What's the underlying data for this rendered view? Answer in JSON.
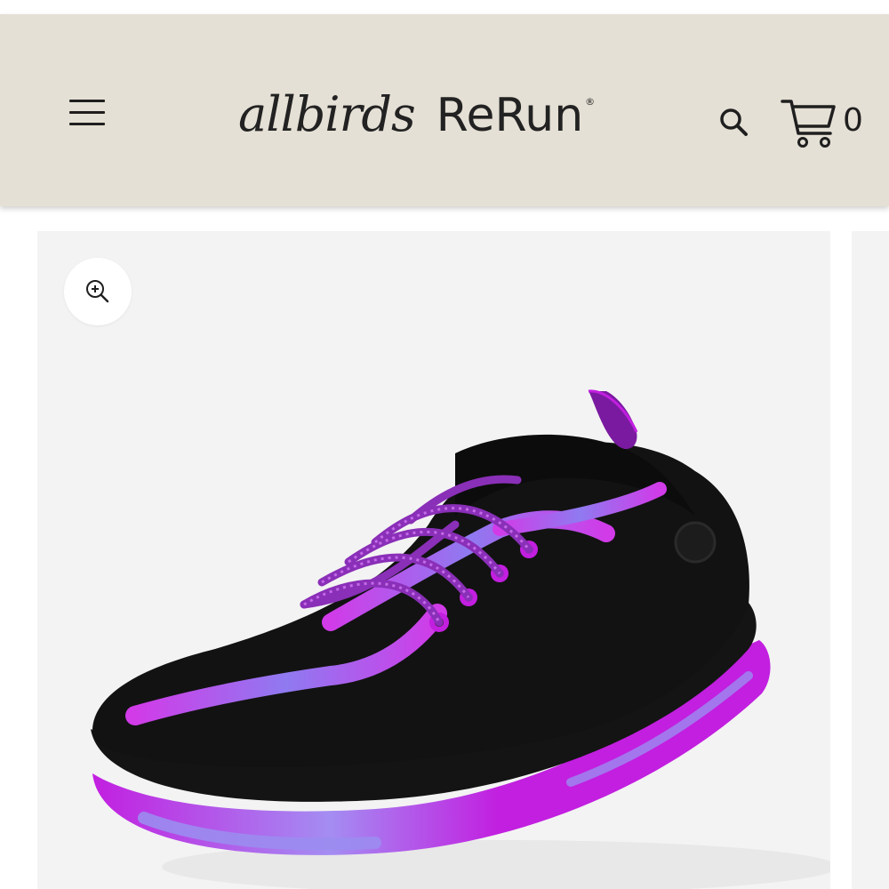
{
  "header": {
    "brand_script": "allbirds",
    "brand_name": "ReRun",
    "brand_mark": "®",
    "cart_count": "0",
    "menu_icon": "hamburger-menu-icon",
    "search_icon": "search-icon",
    "cart_icon": "cart-icon"
  },
  "colors": {
    "header_bg": "#e5e0d5",
    "gallery_bg": "#f3f3f3",
    "shoe_accent": "#c21fe0",
    "shoe_body": "#121212",
    "sole_secondary": "#9b8cf0"
  },
  "gallery": {
    "zoom_icon": "zoom-in-icon",
    "product_image": "black-purple-trail-runner-sneaker"
  }
}
